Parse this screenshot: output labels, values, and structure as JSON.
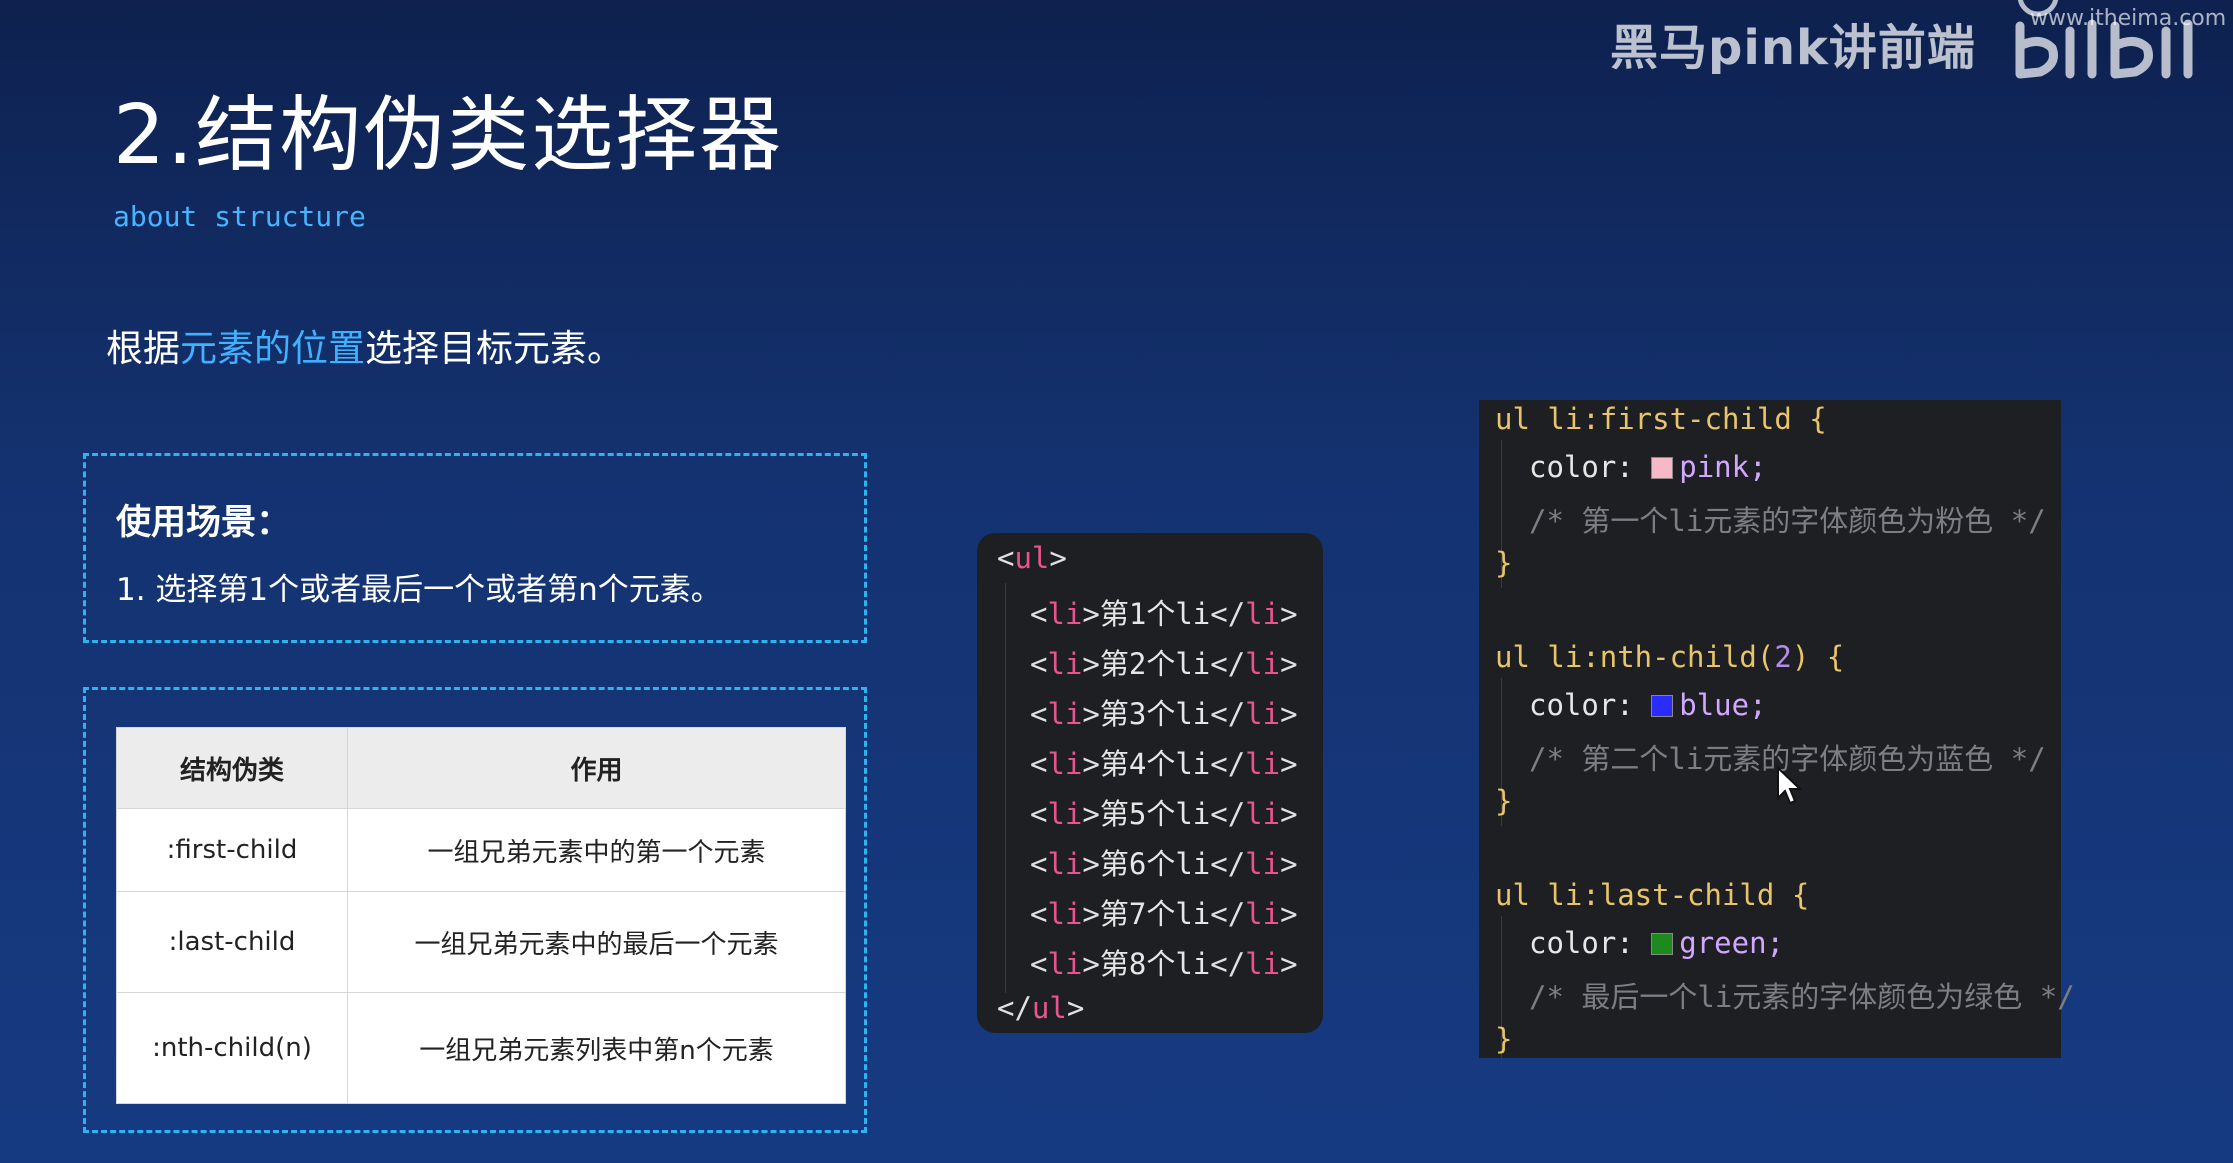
{
  "watermark": {
    "text": "黑马pink讲前端",
    "url": "www.itheima.com"
  },
  "slide": {
    "title": "2.结构伪类选择器",
    "subtitle": "about structure",
    "intro_prefix": "根据",
    "intro_highlight": "元素的位置",
    "intro_suffix": "选择目标元素。"
  },
  "usage": {
    "heading": "使用场景：",
    "item": "1. 选择第1个或者最后一个或者第n个元素。"
  },
  "table": {
    "headers": [
      "结构伪类",
      "作用"
    ],
    "rows": [
      [
        ":first-child",
        "一组兄弟元素中的第一个元素"
      ],
      [
        ":last-child",
        "一组兄弟元素中的最后一个元素"
      ],
      [
        ":nth-child(n)",
        "一组兄弟元素列表中第n个元素"
      ]
    ]
  },
  "html_code": {
    "open_tag": "ul",
    "item_tag": "li",
    "items": [
      "第1个li",
      "第2个li",
      "第3个li",
      "第4个li",
      "第5个li",
      "第6个li",
      "第7个li",
      "第8个li"
    ]
  },
  "css_code": {
    "blocks": [
      {
        "selector": "ul li:first-child",
        "arg": "",
        "property": "color:",
        "value": "pink;",
        "swatch": "#f7b8c8",
        "comment": "/* 第一个li元素的字体颜色为粉色 */"
      },
      {
        "selector": "ul li:nth-child(",
        "arg": "2",
        "selector_end": ")",
        "property": "color:",
        "value": "blue;",
        "swatch": "#2a2cff",
        "comment": "/* 第二个li元素的字体颜色为蓝色 */"
      },
      {
        "selector": "ul li:last-child",
        "arg": "",
        "property": "color:",
        "value": "green;",
        "swatch": "#1e8a1e",
        "comment": "/* 最后一个li元素的字体颜色为绿色 */"
      }
    ],
    "brace_open": "{",
    "brace_close": "}"
  }
}
